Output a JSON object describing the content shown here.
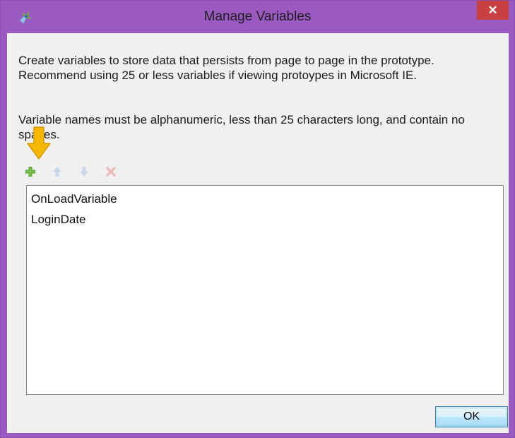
{
  "window": {
    "title": "Manage Variables",
    "close_label": "✕",
    "app_icon": "axure-app-icon",
    "frame_color": "#9b59c2",
    "close_color": "#c84040"
  },
  "description": {
    "paragraph1": "Create variables to store data that persists from page to page in the prototype. Recommend using 25 or less variables if viewing protoypes in Microsoft IE.",
    "paragraph2": "Variable names must be alphanumeric, less than 25 characters long, and contain no spaces."
  },
  "toolbar": {
    "add_icon": "plus-icon",
    "move_up_icon": "arrow-up-icon",
    "move_down_icon": "arrow-down-icon",
    "delete_icon": "delete-x-icon"
  },
  "variables": {
    "items": [
      "OnLoadVariable",
      "LoginDate"
    ]
  },
  "buttons": {
    "ok_label": "OK"
  },
  "annotation": {
    "arrow_color": "#f5b800",
    "arrow_icon": "down-arrow-callout-icon"
  }
}
